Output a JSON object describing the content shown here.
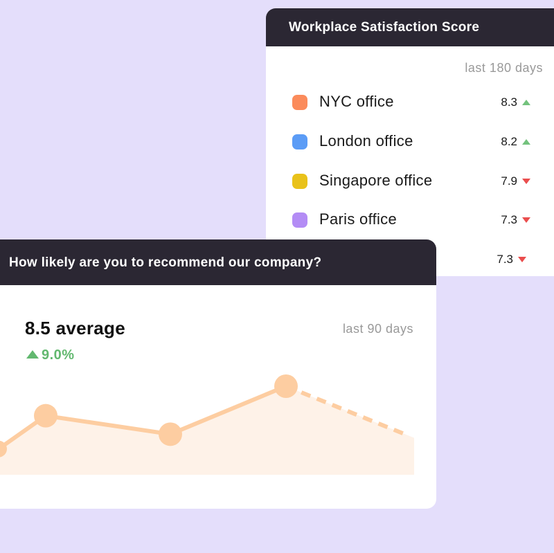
{
  "satisfaction_card": {
    "title": "Workplace Satisfaction Score",
    "period": "last 180 days",
    "offices": [
      {
        "name": "NYC office",
        "score": "8.3",
        "trend": "up",
        "color": "#fb8b5b"
      },
      {
        "name": "London office",
        "score": "8.2",
        "trend": "up",
        "color": "#5b9cf6"
      },
      {
        "name": "Singapore office",
        "score": "7.9",
        "trend": "down",
        "color": "#e9c21a"
      },
      {
        "name": "Paris office",
        "score": "7.3",
        "trend": "down",
        "color": "#b38cf5"
      },
      {
        "name": "",
        "score": "7.3",
        "trend": "down",
        "color": ""
      }
    ]
  },
  "recommend_card": {
    "title": "How likely are you to recommend our company?",
    "average": "8.5 average",
    "change": "9.0%",
    "period": "last 90 days"
  },
  "chart_data": {
    "type": "line",
    "x": [
      0,
      1,
      2,
      3,
      4,
      5
    ],
    "values": [
      6.6,
      7.5,
      7.0,
      7.0,
      8.3,
      6.9
    ],
    "projected_from_index": 4,
    "ylim": [
      5.9,
      8.9
    ],
    "line_color": "#fdcda1",
    "fill_color": "#fef2e8",
    "grid": false
  },
  "colors": {
    "background": "#e4defb",
    "header": "#2b2733",
    "up": "#73c27d",
    "down": "#ea4d4d"
  }
}
